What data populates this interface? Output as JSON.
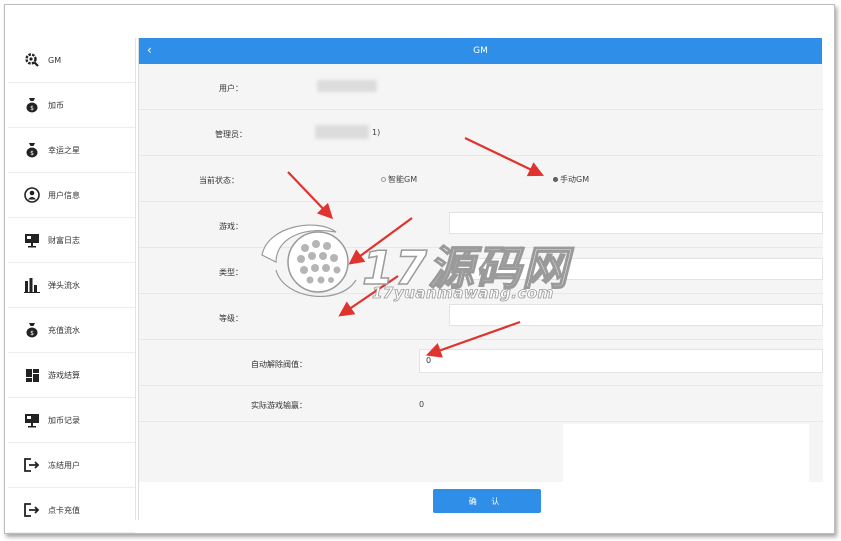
{
  "sidebar": {
    "items": [
      {
        "label": "GM",
        "icon": "gm-gear-icon"
      },
      {
        "label": "加币",
        "icon": "money-bag-icon"
      },
      {
        "label": "幸运之星",
        "icon": "money-bag-icon"
      },
      {
        "label": "用户信息",
        "icon": "user-icon"
      },
      {
        "label": "财富日志",
        "icon": "monitor-icon"
      },
      {
        "label": "弹头流水",
        "icon": "bar-chart-icon"
      },
      {
        "label": "充值流水",
        "icon": "money-bag-icon"
      },
      {
        "label": "游戏结算",
        "icon": "grid-icon"
      },
      {
        "label": "加币记录",
        "icon": "monitor-icon"
      },
      {
        "label": "冻结用户",
        "icon": "logout-icon"
      },
      {
        "label": "点卡充值",
        "icon": "logout-icon"
      }
    ]
  },
  "header": {
    "back_glyph": "‹",
    "title": "GM"
  },
  "form": {
    "user_label": "用户：",
    "admin_label": "管理员：",
    "admin_suffix": "1)",
    "status_label": "当前状态：",
    "status_options": [
      "智能GM",
      "手动GM"
    ],
    "status_selected": "手动GM",
    "game_label": "游戏：",
    "type_label": "类型：",
    "level_label": "等级：",
    "auto_release_label": "自动解除阀值：",
    "auto_release_value": "0",
    "actual_win_label": "实际游戏输赢：",
    "actual_win_value": "0"
  },
  "confirm_label": "确 认",
  "watermark": {
    "main": "17源码网",
    "sub": "17yuanmawang.com"
  },
  "colors": {
    "accent": "#2f8fe8",
    "arrow": "#e0332e"
  }
}
